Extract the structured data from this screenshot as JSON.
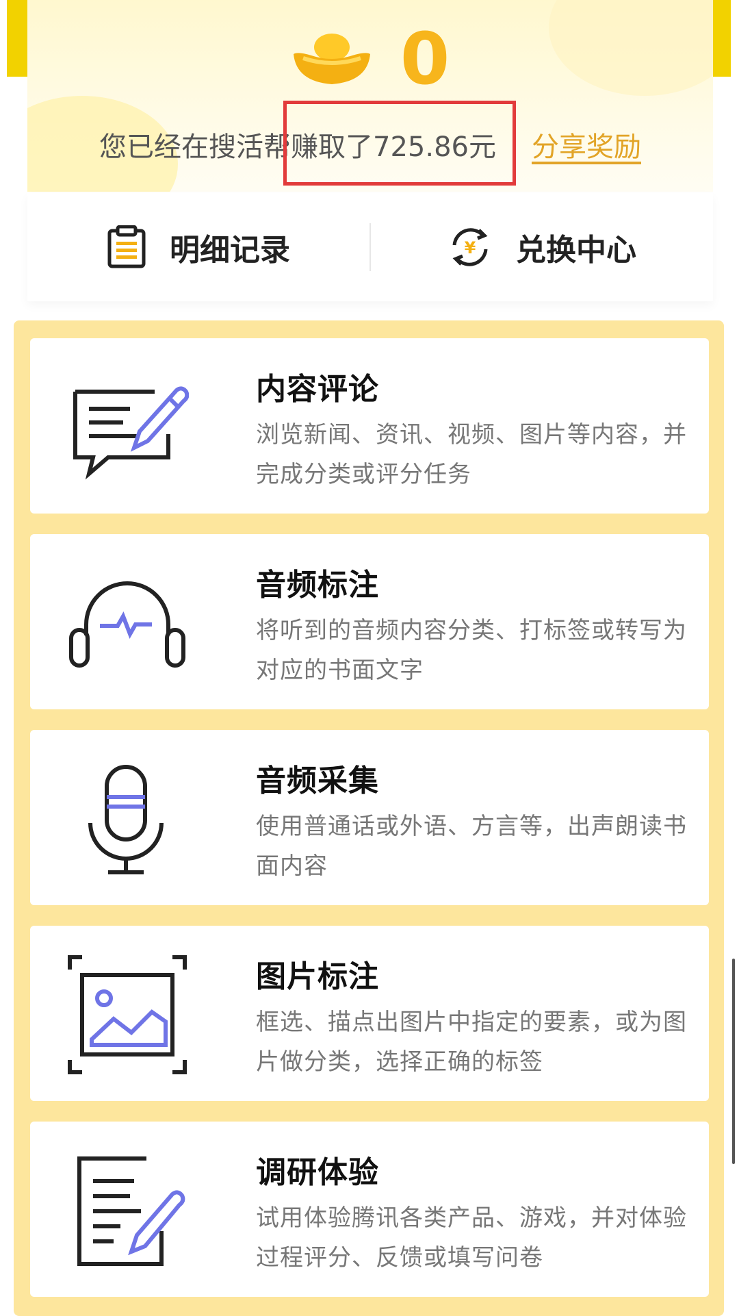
{
  "header": {
    "coin_count": "0",
    "earn_prefix": "您已经在搜活帮",
    "earn_highlight": "赚取了725.86元",
    "share_label": "分享奖励"
  },
  "quick_links": [
    {
      "label": "明细记录",
      "icon": "clipboard-icon"
    },
    {
      "label": "兑换中心",
      "icon": "yuan-exchange-icon"
    }
  ],
  "tasks": [
    {
      "title": "内容评论",
      "desc": "浏览新闻、资讯、视频、图片等内容，并完成分类或评分任务",
      "icon": "comment-edit-icon"
    },
    {
      "title": "音频标注",
      "desc": "将听到的音频内容分类、打标签或转写为对应的书面文字",
      "icon": "headphones-icon"
    },
    {
      "title": "音频采集",
      "desc": "使用普通话或外语、方言等，出声朗读书面内容",
      "icon": "microphone-icon"
    },
    {
      "title": "图片标注",
      "desc": "框选、描点出图片中指定的要素，或为图片做分类，选择正确的标签",
      "icon": "image-frame-icon"
    },
    {
      "title": "调研体验",
      "desc": "试用体验腾讯各类产品、游戏，并对体验过程评分、反馈或填写问卷",
      "icon": "survey-edit-icon"
    }
  ],
  "colors": {
    "accent_yellow": "#f2d200",
    "coin_orange": "#f7b51c",
    "panel_yellow": "#fde69d",
    "highlight_red": "#e23b3b",
    "icon_blue": "#6f74e6"
  }
}
